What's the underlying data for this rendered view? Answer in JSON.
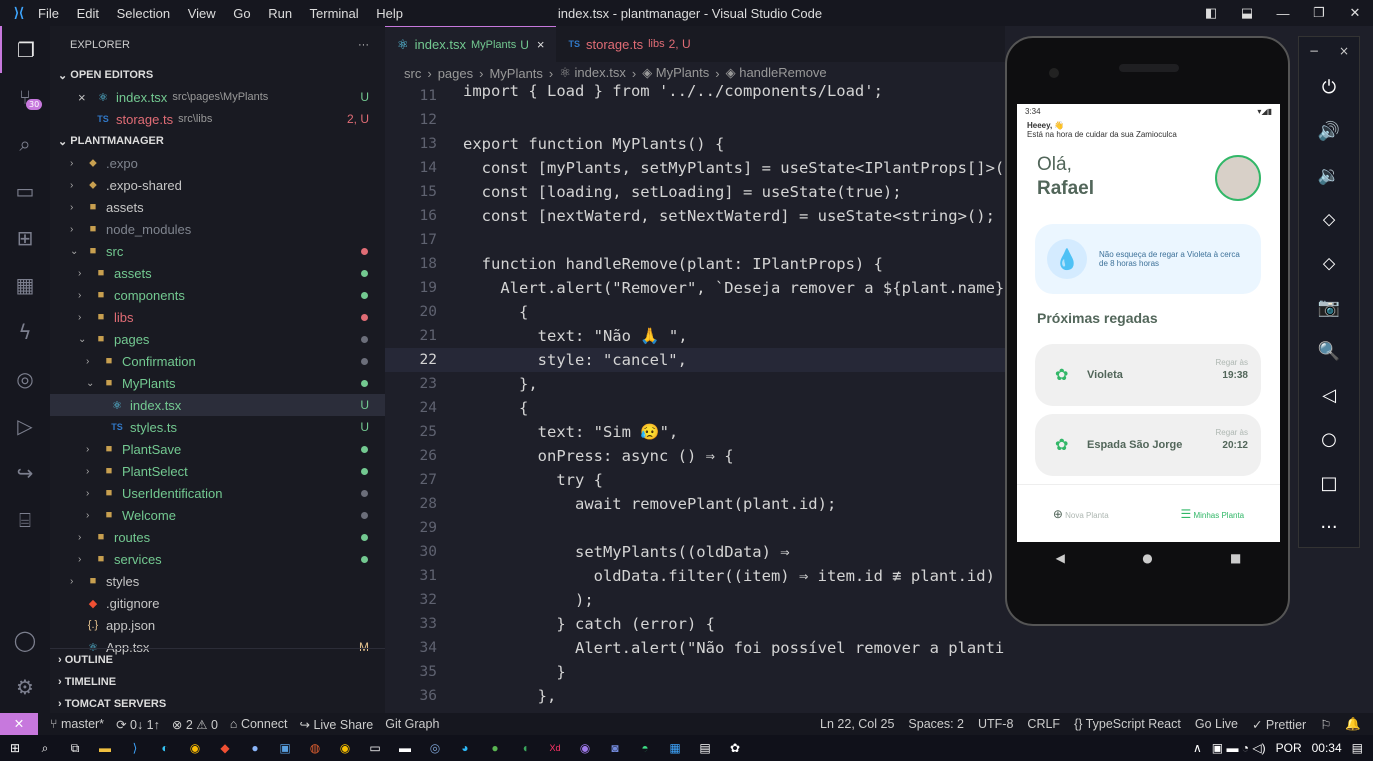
{
  "titlebar": {
    "logo": "⟩⟨",
    "menu": [
      "File",
      "Edit",
      "Selection",
      "View",
      "Go",
      "Run",
      "Terminal",
      "Help"
    ],
    "title": "index.tsx - plantmanager - Visual Studio Code"
  },
  "sidebar": {
    "header": "EXPLORER",
    "more": "···",
    "open_editors": "OPEN EDITORS",
    "project": "PLANTMANAGER",
    "outline": "OUTLINE",
    "timeline": "TIMELINE",
    "tomcat": "TOMCAT SERVERS",
    "open_files": [
      {
        "close": "×",
        "name": "index.tsx",
        "hint": "src\\pages\\MyPlants",
        "status": "U"
      },
      {
        "name": "storage.ts",
        "hint": "src\\libs",
        "status": "2, U"
      }
    ],
    "tree": [
      {
        "indent": 0,
        "chev": "›",
        "icon": "⬥",
        "name": ".expo",
        "cls": "mut"
      },
      {
        "indent": 0,
        "chev": "›",
        "icon": "⬥",
        "name": ".expo-shared",
        "cls": ""
      },
      {
        "indent": 0,
        "chev": "›",
        "icon": "■",
        "name": "assets",
        "cls": ""
      },
      {
        "indent": 0,
        "chev": "›",
        "icon": "■",
        "name": "node_modules",
        "cls": "mut"
      },
      {
        "indent": 0,
        "chev": "⌄",
        "icon": "■",
        "name": "src",
        "cls": "g",
        "dot": "r"
      },
      {
        "indent": 1,
        "chev": "›",
        "icon": "■",
        "name": "assets",
        "cls": "g",
        "dot": "g"
      },
      {
        "indent": 1,
        "chev": "›",
        "icon": "■",
        "name": "components",
        "cls": "g",
        "dot": "g"
      },
      {
        "indent": 1,
        "chev": "›",
        "icon": "■",
        "name": "libs",
        "cls": "r",
        "dot": "r"
      },
      {
        "indent": 1,
        "chev": "⌄",
        "icon": "■",
        "name": "pages",
        "cls": "g",
        "dot": "m"
      },
      {
        "indent": 2,
        "chev": "›",
        "icon": "■",
        "name": "Confirmation",
        "cls": "g",
        "dot": "m"
      },
      {
        "indent": 2,
        "chev": "⌄",
        "icon": "■",
        "name": "MyPlants",
        "cls": "g",
        "dot": "g"
      },
      {
        "indent": 3,
        "chev": "",
        "icon": "⚛",
        "name": "index.tsx",
        "cls": "g",
        "st": "U",
        "sel": true
      },
      {
        "indent": 3,
        "chev": "",
        "icon": "TS",
        "name": "styles.ts",
        "cls": "g",
        "st": "U"
      },
      {
        "indent": 2,
        "chev": "›",
        "icon": "■",
        "name": "PlantSave",
        "cls": "g",
        "dot": "g"
      },
      {
        "indent": 2,
        "chev": "›",
        "icon": "■",
        "name": "PlantSelect",
        "cls": "g",
        "dot": "g"
      },
      {
        "indent": 2,
        "chev": "›",
        "icon": "■",
        "name": "UserIdentification",
        "cls": "g",
        "dot": "m"
      },
      {
        "indent": 2,
        "chev": "›",
        "icon": "■",
        "name": "Welcome",
        "cls": "g",
        "dot": "m"
      },
      {
        "indent": 1,
        "chev": "›",
        "icon": "■",
        "name": "routes",
        "cls": "g",
        "dot": "g"
      },
      {
        "indent": 1,
        "chev": "›",
        "icon": "■",
        "name": "services",
        "cls": "g",
        "dot": "g"
      },
      {
        "indent": 0,
        "chev": "›",
        "icon": "■",
        "name": "styles",
        "cls": ""
      },
      {
        "indent": 0,
        "chev": "",
        "icon": "◆",
        "name": ".gitignore",
        "cls": ""
      },
      {
        "indent": 0,
        "chev": "",
        "icon": "{.}",
        "name": "app.json",
        "cls": ""
      },
      {
        "indent": 0,
        "chev": "",
        "icon": "⚛",
        "name": "App.tsx",
        "cls": "",
        "st": "M"
      }
    ]
  },
  "tabs": [
    {
      "icon": "⚛",
      "name": "index.tsx",
      "hint": "MyPlants",
      "status": "U",
      "close": "×"
    },
    {
      "icon": "TS",
      "name": "storage.ts",
      "hint": "libs",
      "status": "2, U"
    }
  ],
  "breadcrumb": [
    "src",
    "›",
    "pages",
    "›",
    "MyPlants",
    "›",
    "⚛ index.tsx",
    "›",
    "◈ MyPlants",
    "›",
    "◈ handleRemove"
  ],
  "code": [
    {
      "n": "11",
      "t": "import { Load } from '../../components/Load';"
    },
    {
      "n": "12",
      "t": ""
    },
    {
      "n": "13",
      "t": "export function MyPlants() {"
    },
    {
      "n": "14",
      "t": "  const [myPlants, setMyPlants] = useState<IPlantProps[]>([]"
    },
    {
      "n": "15",
      "t": "  const [loading, setLoading] = useState(true);"
    },
    {
      "n": "16",
      "t": "  const [nextWaterd, setNextWaterd] = useState<string>();"
    },
    {
      "n": "17",
      "t": ""
    },
    {
      "n": "18",
      "t": "  function handleRemove(plant: IPlantProps) {"
    },
    {
      "n": "19",
      "t": "    Alert.alert(\"Remover\", `Deseja remover a ${plant.name}?`"
    },
    {
      "n": "20",
      "t": "      {"
    },
    {
      "n": "21",
      "t": "        text: \"Não 🙏 \","
    },
    {
      "n": "22",
      "t": "        style: \"cancel\",",
      "cur": true
    },
    {
      "n": "23",
      "t": "      },"
    },
    {
      "n": "24",
      "t": "      {"
    },
    {
      "n": "25",
      "t": "        text: \"Sim 😥\","
    },
    {
      "n": "26",
      "t": "        onPress: async () ⇒ {"
    },
    {
      "n": "27",
      "t": "          try {"
    },
    {
      "n": "28",
      "t": "            await removePlant(plant.id);"
    },
    {
      "n": "29",
      "t": ""
    },
    {
      "n": "30",
      "t": "            setMyPlants((oldData) ⇒"
    },
    {
      "n": "31",
      "t": "              oldData.filter((item) ⇒ item.id ≢ plant.id)"
    },
    {
      "n": "32",
      "t": "            );"
    },
    {
      "n": "33",
      "t": "          } catch (error) {"
    },
    {
      "n": "34",
      "t": "            Alert.alert(\"Não foi possível remover a plantinha\");"
    },
    {
      "n": "35",
      "t": "          }"
    },
    {
      "n": "36",
      "t": "        },"
    },
    {
      "n": "37",
      "t": "      }"
    }
  ],
  "status": {
    "remote": "✕",
    "branch": "master*",
    "sync": "⟳ 0↓ 1↑",
    "problems": "⊗ 2 ⚠ 0",
    "connect": "Connect",
    "liveshare": "Live Share",
    "gitgraph": "Git Graph",
    "right": [
      "Ln 22, Col 25",
      "Spaces: 2",
      "UTF-8",
      "CRLF",
      "{} TypeScript React",
      "Go Live",
      "✓ Prettier"
    ]
  },
  "taskbar": {
    "lang": "POR",
    "time": "00:34"
  },
  "phone": {
    "time": "3:34",
    "greet_top": "Heeey, 👋",
    "subtitle": "Está na hora de cuidar da sua Zamioculca",
    "hello": "Olá,",
    "name": "Rafael",
    "tip": "Não esqueça de regar a Violeta à cerca de 8 horas horas",
    "section": "Próximas regadas",
    "plants": [
      {
        "name": "Violeta",
        "label": "Regar às",
        "time": "19:38"
      },
      {
        "name": "Espada São Jorge",
        "label": "Regar às",
        "time": "20:12"
      }
    ],
    "nav_new": "Nova Planta",
    "nav_mine": "Minhas Planta"
  },
  "emulator": [
    "−",
    "×",
    "⏻",
    "🔊",
    "🔉",
    "⬦",
    "⬦",
    "📷",
    "🔍",
    "◁",
    "○",
    "□",
    "···"
  ]
}
